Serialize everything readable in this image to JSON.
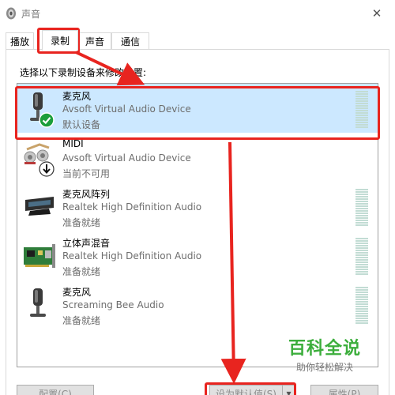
{
  "window": {
    "title": "声音"
  },
  "tabs": [
    {
      "label": "播放",
      "active": false
    },
    {
      "label": "录制",
      "active": true
    },
    {
      "label": "声音",
      "active": false
    },
    {
      "label": "通信",
      "active": false
    }
  ],
  "instruction": "选择以下录制设备来修改设置:",
  "devices": [
    {
      "name": "麦克风",
      "driver": "Avsoft Virtual Audio Device",
      "status": "默认设备",
      "icon": "microphone-icon",
      "selected": true,
      "badge": "default-check"
    },
    {
      "name": "MIDI",
      "driver": "Avsoft Virtual Audio Device",
      "status": "当前不可用",
      "icon": "midi-cable-icon",
      "selected": false,
      "badge": "unavailable-arrow"
    },
    {
      "name": "麦克风阵列",
      "driver": "Realtek High Definition Audio",
      "status": "准备就绪",
      "icon": "microphone-array-icon",
      "selected": false
    },
    {
      "name": "立体声混音",
      "driver": "Realtek High Definition Audio",
      "status": "准备就绪",
      "icon": "sound-card-icon",
      "selected": false
    },
    {
      "name": "麦克风",
      "driver": "Screaming Bee Audio",
      "status": "准备就绪",
      "icon": "microphone-icon",
      "selected": false
    }
  ],
  "buttons": {
    "configure": "配置(C)",
    "set_default": "设为默认值(S)",
    "properties": "属性(P)"
  },
  "watermark": {
    "main": "百科全说",
    "sub": "助你轻松解决"
  },
  "colors": {
    "annotation": "#e8241f",
    "selection": "#cce8ff",
    "watermark": "#3cae3c"
  }
}
